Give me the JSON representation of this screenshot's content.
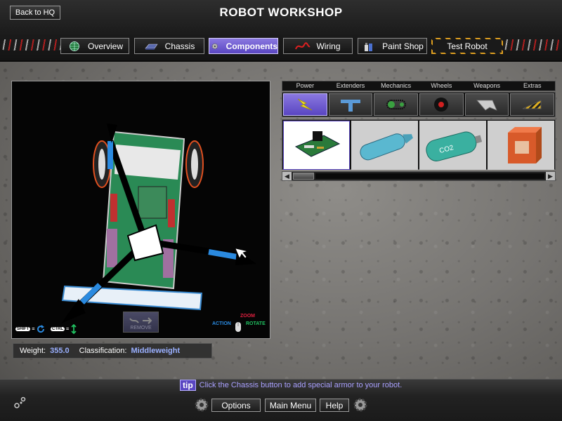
{
  "header": {
    "back_label": "Back to HQ",
    "title": "ROBOT WORKSHOP"
  },
  "tabs": [
    {
      "label": "Overview",
      "icon": "globe-icon"
    },
    {
      "label": "Chassis",
      "icon": "chassis-icon"
    },
    {
      "label": "Components",
      "icon": "gear-icon",
      "active": true
    },
    {
      "label": "Wiring",
      "icon": "wire-icon"
    },
    {
      "label": "Paint Shop",
      "icon": "paint-icon"
    },
    {
      "label": "Test Robot",
      "icon": ""
    }
  ],
  "viewport": {
    "remove_label": "REMOVE",
    "shift_key": "SHIFT",
    "ctrl_key": "CTRL",
    "action_label": "ACTION",
    "zoom_label": "ZOOM",
    "rotate_label": "ROTATE"
  },
  "stats": {
    "weight_label": "Weight:",
    "weight_value": "355.0",
    "class_label": "Classification:",
    "class_value": "Middleweight"
  },
  "categories": [
    "Power",
    "Extenders",
    "Mechanics",
    "Wheels",
    "Weapons",
    "Extras"
  ],
  "parts": [
    {
      "name": "circuit-board",
      "label": ""
    },
    {
      "name": "battery-canister",
      "label": ""
    },
    {
      "name": "co2-tank",
      "label": "CO2"
    },
    {
      "name": "battery-box",
      "label": ""
    }
  ],
  "tip": {
    "badge": "tip",
    "text": "Click the Chassis button to add special armor to your robot."
  },
  "bottom": {
    "options_label": "Options",
    "main_menu_label": "Main Menu",
    "help_label": "Help"
  },
  "colors": {
    "accent": "#6a56d0",
    "tip_text": "#a9a0ff",
    "stat_value": "#9ab0ff"
  }
}
